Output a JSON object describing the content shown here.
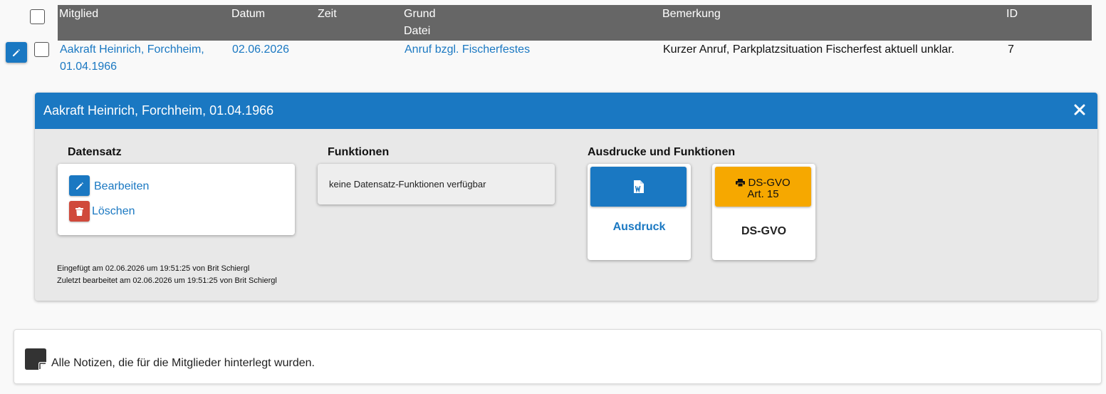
{
  "table": {
    "headers": {
      "member": "Mitglied",
      "date": "Datum",
      "time": "Zeit",
      "reason": "Grund",
      "file": "Datei",
      "remark": "Bemerkung",
      "id": "ID"
    },
    "row": {
      "member_line1": "Aakraft Heinrich, Forchheim,",
      "member_line2": "01.04.1966",
      "date": "02.06.2026",
      "time": "",
      "reason": "Anruf bzgl. Fischerfestes",
      "remark": "Kurzer Anruf, Parkplatzsituation Fischerfest aktuell unklar.",
      "id": "7"
    }
  },
  "panel": {
    "title": "Aakraft Heinrich, Forchheim, 01.04.1966",
    "record": {
      "title": "Datensatz",
      "edit_label": "Bearbeiten",
      "delete_label": "Löschen"
    },
    "functions": {
      "title": "Funktionen",
      "empty_text": "keine Datensatz-Funktionen verfügbar"
    },
    "prints": {
      "title": "Ausdrucke und Funktionen",
      "print_label": "Ausdruck",
      "dsgvo_button_line1": "DS-GVO",
      "dsgvo_button_line2": "Art. 15",
      "dsgvo_label": "DS-GVO"
    },
    "meta": {
      "inserted": "Eingefügt am 02.06.2026 um 19:51:25 von Brit Schiergl",
      "edited": "Zuletzt bearbeitet am 02.06.2026 um 19:51:25 von Brit Schiergl"
    }
  },
  "notes": {
    "text": "Alle Notizen, die für die Mitglieder hinterlegt wurden."
  },
  "colors": {
    "primary": "#1a78c2",
    "header_bg": "#666666",
    "danger": "#d0493b",
    "warning": "#f6a800"
  },
  "icons": {
    "edit": "pencil-icon",
    "delete": "trash-icon",
    "close": "close-icon",
    "document": "word-document-icon",
    "print": "printer-icon",
    "notes": "sticky-note-icon"
  }
}
